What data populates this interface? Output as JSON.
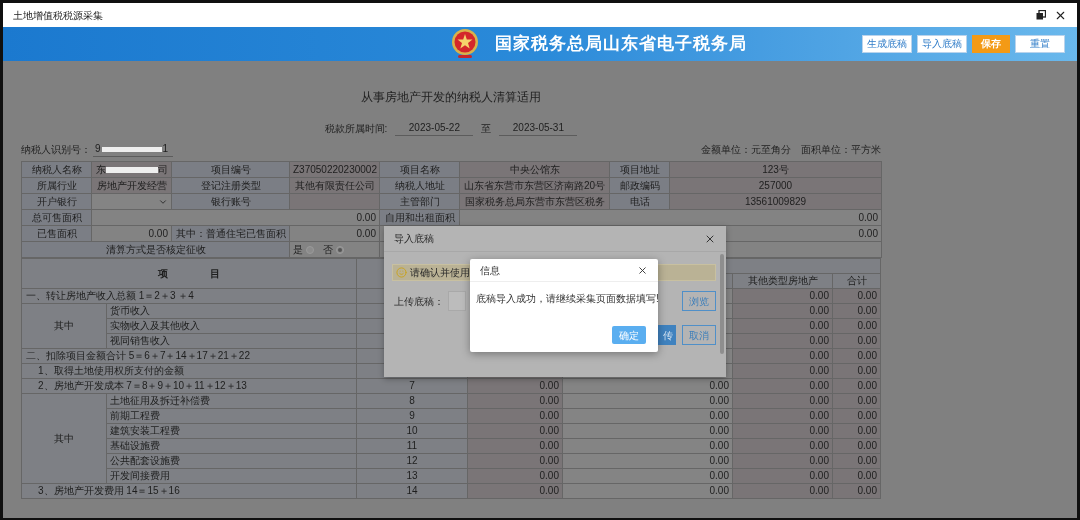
{
  "window": {
    "title": "土地增值税税源采集"
  },
  "banner": {
    "title": "国家税务总局山东省电子税务局",
    "buttons": [
      {
        "label": "生成底稿",
        "kind": "plain"
      },
      {
        "label": "导入底稿",
        "kind": "plain"
      },
      {
        "label": "保存",
        "kind": "primary"
      },
      {
        "label": "重置",
        "kind": "plain"
      }
    ]
  },
  "form": {
    "title": "从事房地产开发的纳税人清算适用",
    "period_label": "税款所属时间:",
    "period_start": "2023-05-22",
    "period_sep": "至",
    "period_end": "2023-05-31",
    "taxpayer_id_label": "纳税人识别号：",
    "taxpayer_id_start": "9",
    "taxpayer_id_end": "1",
    "amount_unit": "金额单位：元至角分",
    "area_unit": "面积单位：平方米"
  },
  "info_table": {
    "rows": [
      {
        "cells": [
          {
            "kind": "label",
            "text": "纳税人名称"
          },
          {
            "kind": "redacted",
            "before": "东",
            "after": "司"
          },
          {
            "kind": "label",
            "text": "项目编号"
          },
          {
            "kind": "readonly",
            "text": "Z37050220230002"
          },
          {
            "kind": "label",
            "text": "项目名称"
          },
          {
            "kind": "readonly",
            "text": "中央公馆东"
          },
          {
            "kind": "label",
            "text": "项目地址"
          },
          {
            "kind": "readonly",
            "text": "123号"
          }
        ]
      },
      {
        "cells": [
          {
            "kind": "label",
            "text": "所属行业"
          },
          {
            "kind": "readonly",
            "text": "房地产开发经营"
          },
          {
            "kind": "label",
            "text": "登记注册类型"
          },
          {
            "kind": "readonly",
            "text": "其他有限责任公司"
          },
          {
            "kind": "label",
            "text": "纳税人地址"
          },
          {
            "kind": "readonly",
            "text": "山东省东营市东营区济南路20号"
          },
          {
            "kind": "label",
            "text": "邮政编码"
          },
          {
            "kind": "readonly",
            "text": "257000"
          }
        ]
      },
      {
        "cells": [
          {
            "kind": "label",
            "text": "开户银行"
          },
          {
            "kind": "select"
          },
          {
            "kind": "label",
            "text": "银行账号"
          },
          {
            "kind": "readonly"
          },
          {
            "kind": "label",
            "text": "主管部门"
          },
          {
            "kind": "readonly",
            "text": "国家税务总局东营市东营区税务"
          },
          {
            "kind": "label",
            "text": "电话"
          },
          {
            "kind": "readonly",
            "text": "13561009829"
          }
        ]
      },
      {
        "cells": [
          {
            "kind": "label",
            "text": "总可售面积"
          },
          {
            "kind": "amount",
            "text": "0.00",
            "colspan": 3
          },
          {
            "kind": "label",
            "text": "自用和出租面积"
          },
          {
            "kind": "amount",
            "text": "0.00",
            "colspan": 3
          }
        ]
      },
      {
        "cells": [
          {
            "kind": "label",
            "text": "已售面积"
          },
          {
            "kind": "amount",
            "text": "0.00"
          },
          {
            "kind": "label",
            "text": "其中：普通住宅已售面积"
          },
          {
            "kind": "amount",
            "text": "0.00"
          },
          {
            "kind": "blank",
            "colspan": 3
          },
          {
            "kind": "amount",
            "text": "0.00"
          }
        ]
      },
      {
        "cells": [
          {
            "kind": "label",
            "text": "清算方式是否核定征收",
            "colspan": 3
          },
          {
            "kind": "radio",
            "options": [
              {
                "label": "是",
                "selected": false
              },
              {
                "label": "否",
                "selected": true
              }
            ]
          },
          {
            "kind": "blank",
            "colspan": 4
          }
        ]
      }
    ]
  },
  "items_table": {
    "columns": {
      "item": "项 目",
      "other_types": "其他类型房地产",
      "total": "合计"
    },
    "rows": [
      {
        "kind": "section",
        "item": "一、转让房地产收入总额 1＝2＋3 ＋4",
        "other_types": "0.00",
        "total": "0.00"
      },
      {
        "kind": "group",
        "label": "其中",
        "rows": [
          {
            "item": "货币收入",
            "other_types": "0.00",
            "total": "0.00"
          },
          {
            "item": "实物收入及其他收入",
            "other_types": "0.00",
            "total": "0.00"
          },
          {
            "item": "视同销售收入",
            "other_types": "0.00",
            "total": "0.00"
          }
        ]
      },
      {
        "kind": "section",
        "item": "二、扣除项目金额合计 5＝6＋7＋14＋17＋21＋22",
        "other_types": "0.00",
        "total": "0.00"
      },
      {
        "kind": "subsection",
        "item": "1、取得土地使用权所支付的金额",
        "other_types": "0.00",
        "total": "0.00"
      },
      {
        "kind": "subsection",
        "item": "2、房地产开发成本 7＝8＋9＋10＋11＋12＋13",
        "line": "7",
        "column_4": "0.00",
        "column_5": "0.00",
        "other_types": "0.00",
        "total": "0.00"
      },
      {
        "kind": "group",
        "label": "其中",
        "rows": [
          {
            "item": "土地征用及拆迁补偿费",
            "line": "8",
            "column_4": "0.00",
            "column_5": "0.00",
            "other_types": "0.00",
            "total": "0.00"
          },
          {
            "item": "前期工程费",
            "line": "9",
            "column_4": "0.00",
            "column_5": "0.00",
            "other_types": "0.00",
            "total": "0.00"
          },
          {
            "item": "建筑安装工程费",
            "line": "10",
            "column_4": "0.00",
            "column_5": "0.00",
            "other_types": "0.00",
            "total": "0.00"
          },
          {
            "item": "基础设施费",
            "line": "11",
            "column_4": "0.00",
            "column_5": "0.00",
            "other_types": "0.00",
            "total": "0.00"
          },
          {
            "item": "公共配套设施费",
            "line": "12",
            "column_4": "0.00",
            "column_5": "0.00",
            "other_types": "0.00",
            "total": "0.00"
          },
          {
            "item": "开发间接费用",
            "line": "13",
            "column_4": "0.00",
            "column_5": "0.00",
            "other_types": "0.00",
            "total": "0.00"
          }
        ]
      },
      {
        "kind": "subsection",
        "item": "3、房地产开发费用 14＝15＋16",
        "line": "14",
        "column_4": "0.00",
        "column_5": "0.00",
        "other_types": "0.00",
        "total": "0.00"
      }
    ]
  },
  "import_dialog": {
    "title": "导入底稿",
    "notice": "请确认并使用",
    "upload_label": "上传底稿：",
    "browse": "浏览",
    "upload_button": "传",
    "cancel": "取消"
  },
  "info_dialog": {
    "title": "信息",
    "message": "底稿导入成功，请继续采集页面数据填写!",
    "ok": "确定"
  }
}
